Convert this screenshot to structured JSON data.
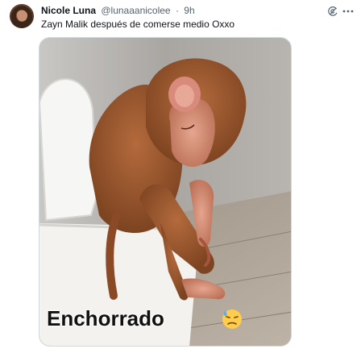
{
  "tweet": {
    "author_name": "Nicole Luna",
    "handle": "@lunaaanicolee",
    "separator": "·",
    "time": "9h",
    "text": "Zayn Malik después de comerse medio Oxxo",
    "media": {
      "caption": "Enchorrado",
      "caption_emoji": "downcast-face-with-sweat-emoji"
    },
    "icons": [
      "grok-icon",
      "more-icon"
    ]
  },
  "colors": {
    "text_primary": "#0f1419",
    "text_secondary": "#536471",
    "media_border": "#cfd9de"
  }
}
